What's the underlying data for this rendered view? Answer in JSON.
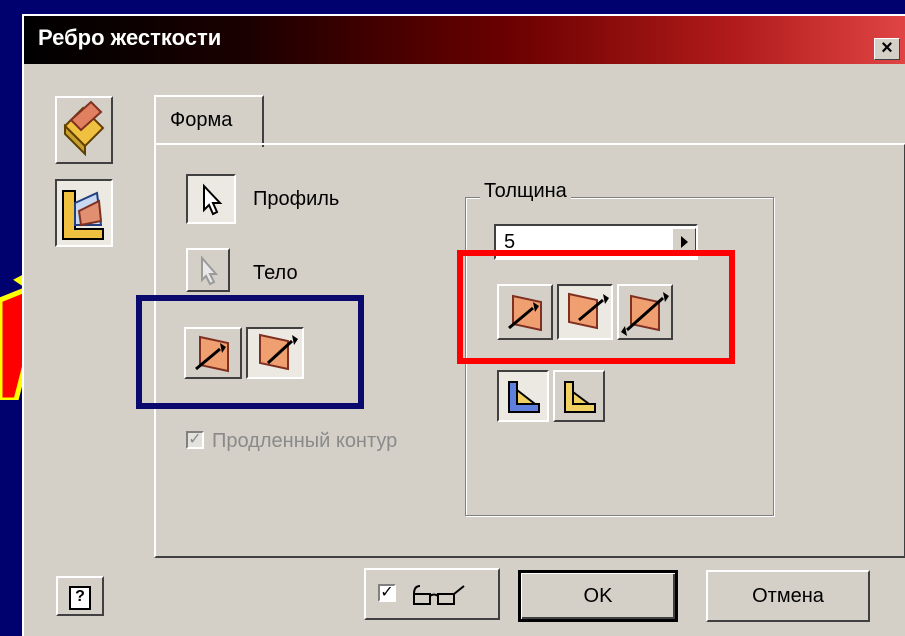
{
  "window": {
    "title": "Ребро жесткости",
    "close_label": "×"
  },
  "tabs": [
    {
      "label": "Форма"
    }
  ],
  "form": {
    "profile_label": "Профиль",
    "body_label": "Тело",
    "extend_profile_label": "Продленный контур",
    "extend_profile_checked": true
  },
  "thickness": {
    "group_title": "Толщина",
    "value": "5"
  },
  "footer": {
    "ok_label": "OK",
    "cancel_label": "Отмена",
    "glasses_checked": true
  },
  "icons": {
    "help": "?",
    "check": "✓"
  },
  "annotations": {
    "red": "#ff0000",
    "navy": "#0a0a6e",
    "arrow_fill": "#ff0000",
    "arrow_stroke": "#ffff00"
  }
}
